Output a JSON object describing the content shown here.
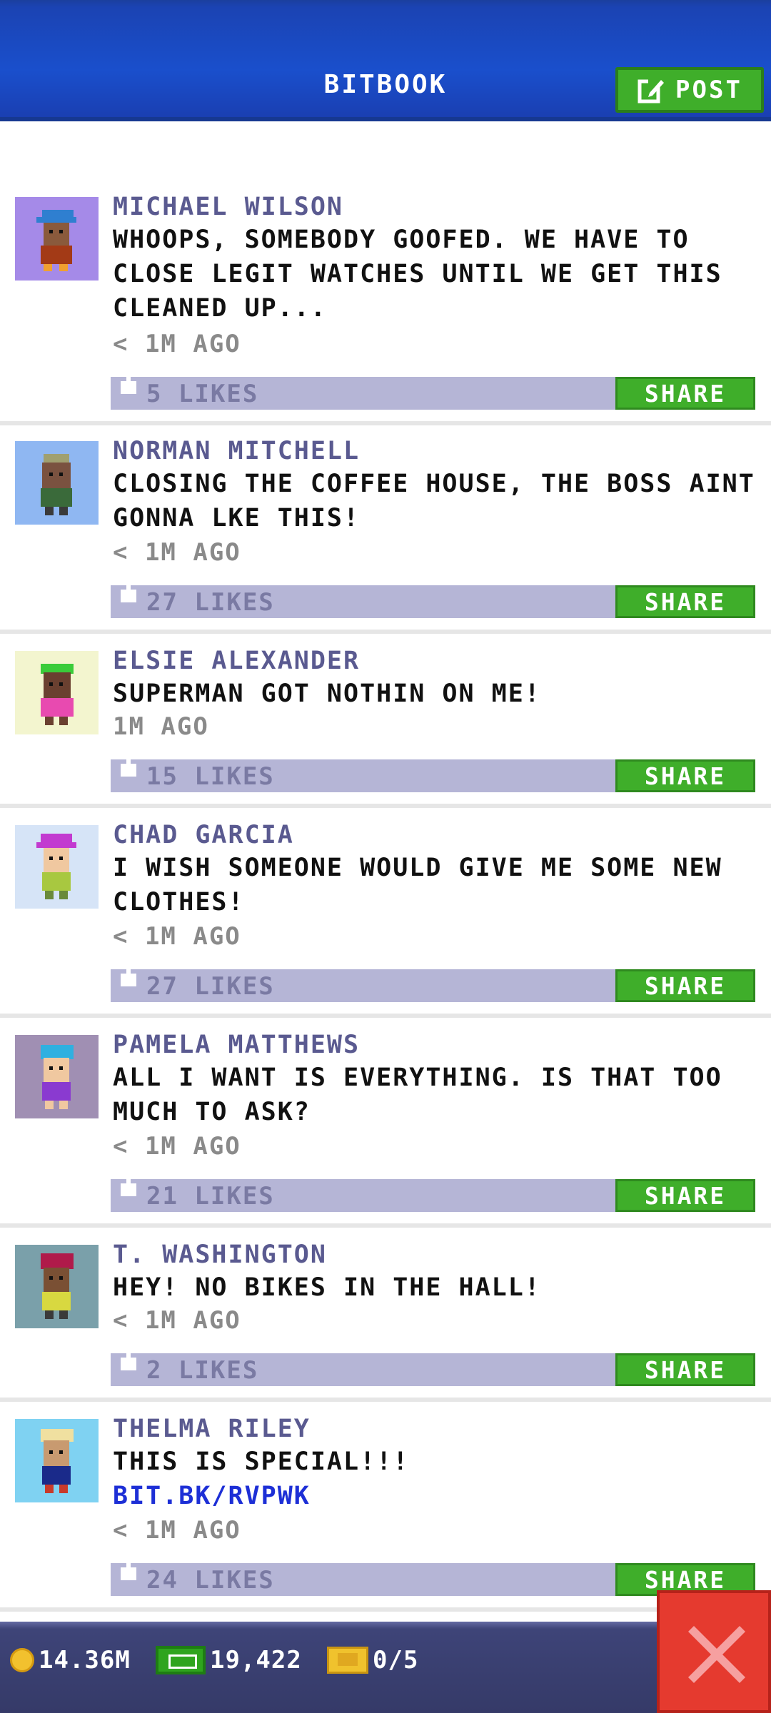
{
  "header": {
    "title": "BITBOOK",
    "post_label": "POST"
  },
  "posts": [
    {
      "name": "MICHAEL WILSON",
      "text": "WHOOPS, SOMEBODY GOOFED. WE HAVE TO CLOSE LEGIT WATCHES UNTIL WE GET THIS CLEANED UP...",
      "time": "< 1M AGO",
      "likes": "5 LIKES",
      "share": "SHARE"
    },
    {
      "name": "NORMAN MITCHELL",
      "text": "CLOSING THE COFFEE HOUSE, THE BOSS AINT GONNA LKE THIS!",
      "time": "< 1M AGO",
      "likes": "27 LIKES",
      "share": "SHARE"
    },
    {
      "name": "ELSIE ALEXANDER",
      "text": "SUPERMAN GOT NOTHIN ON ME!",
      "time": "1M AGO",
      "likes": "15 LIKES",
      "share": "SHARE"
    },
    {
      "name": "CHAD GARCIA",
      "text": "I WISH SOMEONE WOULD GIVE ME SOME NEW CLOTHES!",
      "time": "< 1M AGO",
      "likes": "27 LIKES",
      "share": "SHARE"
    },
    {
      "name": "PAMELA MATTHEWS",
      "text": "ALL I WANT IS EVERYTHING. IS THAT TOO MUCH TO ASK?",
      "time": "< 1M AGO",
      "likes": "21 LIKES",
      "share": "SHARE"
    },
    {
      "name": "T. WASHINGTON",
      "text": "HEY! NO BIKES IN THE HALL!",
      "time": "< 1M AGO",
      "likes": "2 LIKES",
      "share": "SHARE"
    },
    {
      "name": "THELMA RILEY",
      "text": "THIS IS SPECIAL!!!",
      "link": "BIT.BK/RVPWK",
      "time": "< 1M AGO",
      "likes": "24 LIKES",
      "share": "SHARE"
    }
  ],
  "bottom_bar": {
    "coins": "14.36M",
    "bux": "19,422",
    "tickets": "0/5"
  },
  "colors": {
    "header": "#1a4fcc",
    "share_green": "#3fae2a",
    "likes_bar": "#b5b5d6",
    "close_red": "#e53a2f"
  },
  "icons": {
    "post": "edit-icon",
    "like": "thumb-up-icon",
    "coin": "coin-icon",
    "bux": "bux-icon",
    "ticket": "ticket-icon",
    "close": "close-icon"
  }
}
